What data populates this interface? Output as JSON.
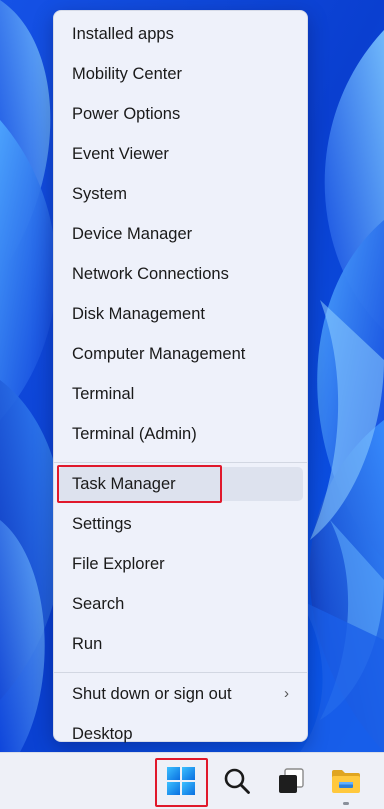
{
  "menu": {
    "items": [
      {
        "label": "Installed apps"
      },
      {
        "label": "Mobility Center"
      },
      {
        "label": "Power Options"
      },
      {
        "label": "Event Viewer"
      },
      {
        "label": "System"
      },
      {
        "label": "Device Manager"
      },
      {
        "label": "Network Connections"
      },
      {
        "label": "Disk Management"
      },
      {
        "label": "Computer Management"
      },
      {
        "label": "Terminal"
      },
      {
        "label": "Terminal (Admin)"
      },
      {
        "label": "Task Manager",
        "hovered": true,
        "highlighted": true
      },
      {
        "label": "Settings"
      },
      {
        "label": "File Explorer"
      },
      {
        "label": "Search"
      },
      {
        "label": "Run"
      },
      {
        "label": "Shut down or sign out",
        "submenu": true
      },
      {
        "label": "Desktop"
      }
    ],
    "submenu_glyph": "›"
  },
  "taskbar": {
    "icons": [
      {
        "name": "start-button",
        "icon": "windows-logo-icon",
        "highlighted": true
      },
      {
        "name": "search-button",
        "icon": "search-icon"
      },
      {
        "name": "task-view-button",
        "icon": "task-view-icon"
      },
      {
        "name": "file-explorer-button",
        "icon": "folder-icon",
        "running": true
      }
    ]
  },
  "colors": {
    "highlight_border": "#e0182b",
    "menu_background": "#eef1fa",
    "taskbar_background": "#eef0f7",
    "accent": "#0078d4"
  }
}
